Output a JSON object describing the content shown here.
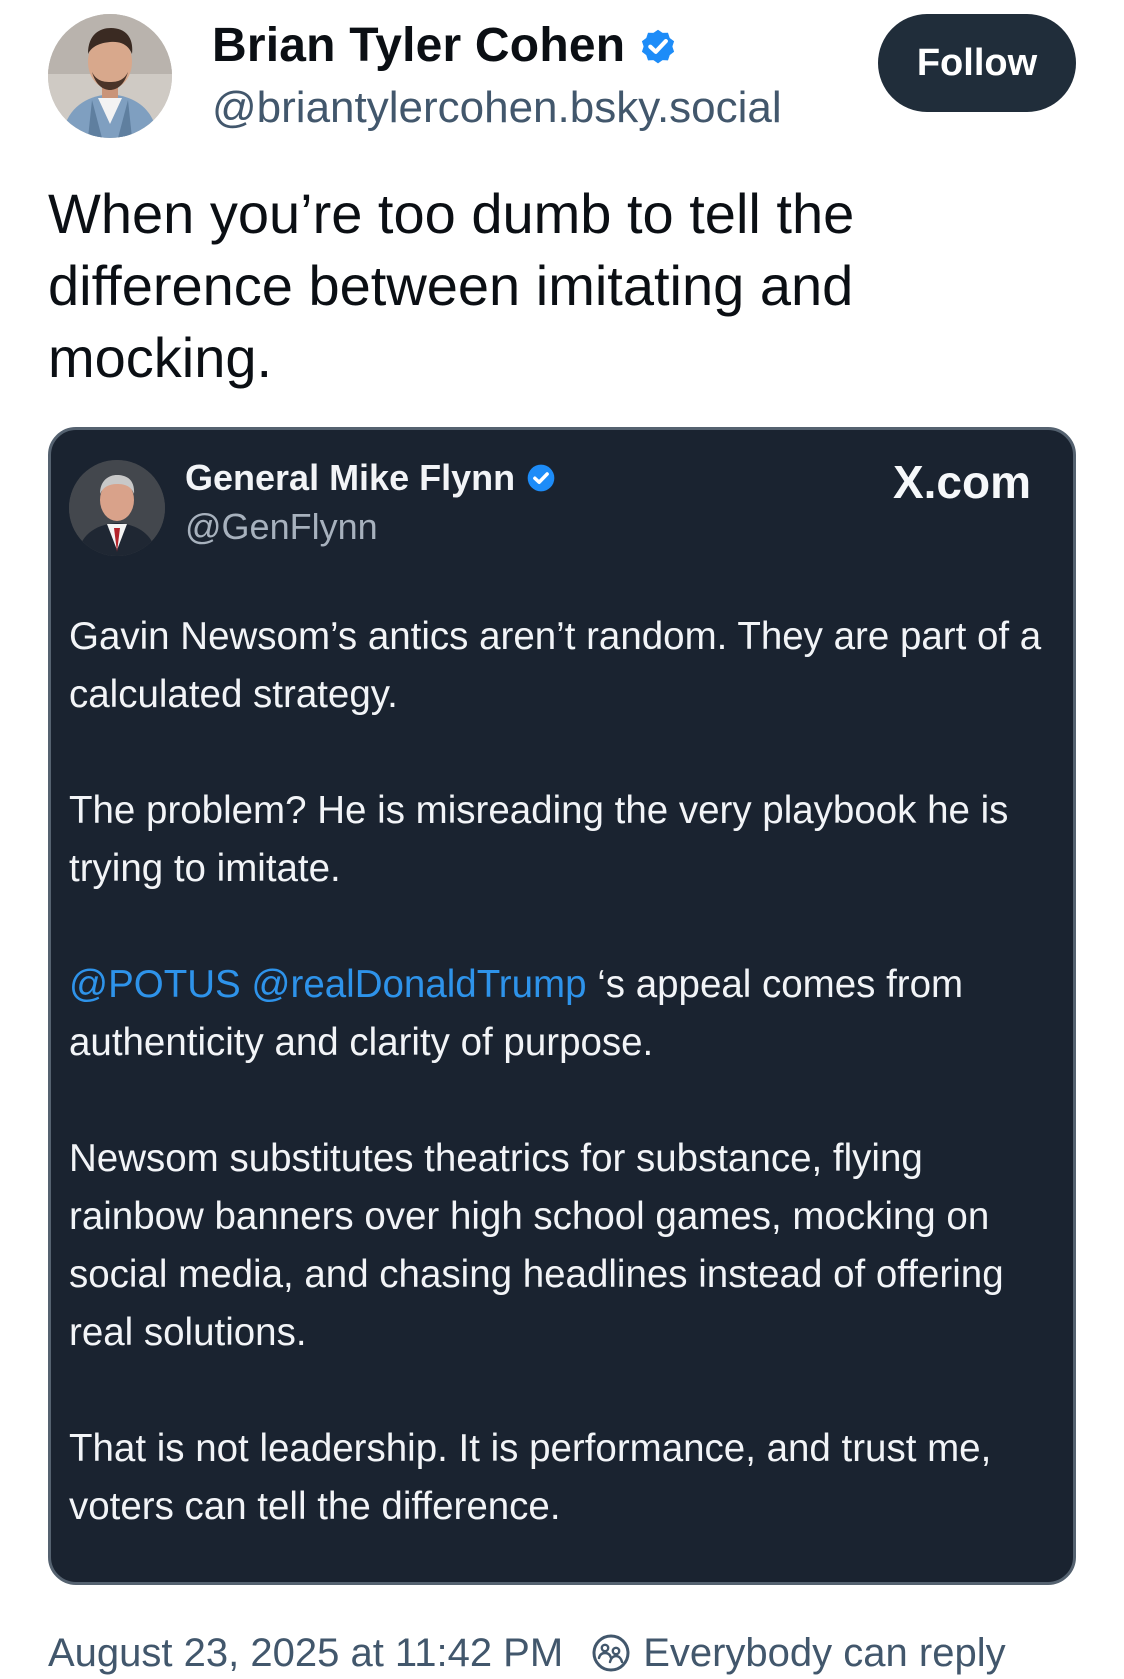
{
  "post": {
    "author": {
      "name": "Brian Tyler Cohen",
      "handle": "@briantylercohen.bsky.social",
      "verified": true,
      "avatar_icon": "profile-photo"
    },
    "follow_label": "Follow",
    "text": "When you’re too dumb to tell the difference between imitating and mocking.",
    "timestamp": "August 23, 2025 at 11:42 PM",
    "reply_setting": "Everybody can reply"
  },
  "embed": {
    "author": {
      "name": "General Mike Flynn",
      "handle": "@GenFlynn",
      "verified": true,
      "avatar_icon": "profile-photo"
    },
    "source": "X.com",
    "paragraphs": [
      "Gavin Newsom’s antics aren’t random. They are part of a calculated strategy.",
      "The problem? He is misreading the very playbook he is trying to imitate."
    ],
    "mention_paragraph": {
      "mention_1": "@POTUS",
      "mention_2": "@realDonaldTrump",
      "rest": " ‘s appeal comes from authenticity and clarity of purpose."
    },
    "paragraphs_after": [
      "Newsom substitutes theatrics for substance, flying rainbow banners over high school games, mocking on social media, and chasing headlines instead of offering real solutions.",
      "That is not leadership. It is performance, and trust me, voters can tell the difference."
    ]
  },
  "colors": {
    "verified_blue": "#1d8cf8",
    "mention_blue": "#2e93ea",
    "follow_button_bg": "#202d3a",
    "embed_bg": "#1a2330",
    "secondary_text": "#42576c"
  }
}
